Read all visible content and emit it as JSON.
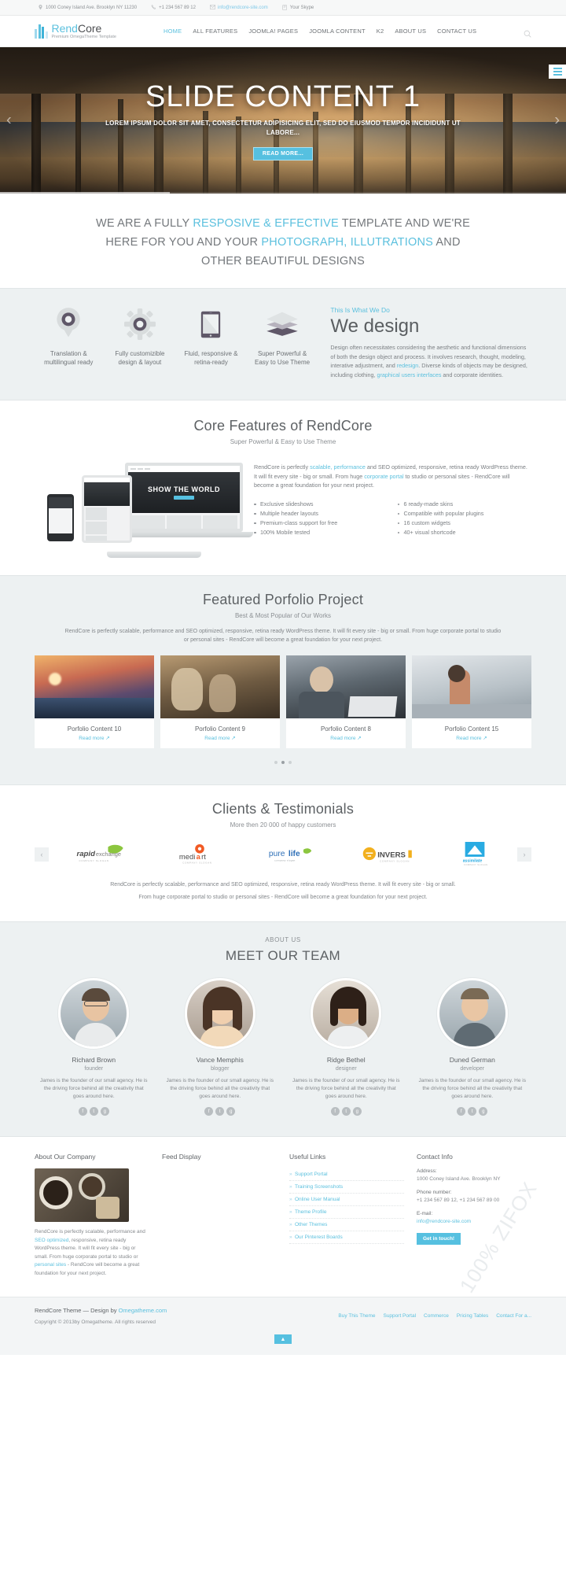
{
  "topbar": {
    "address": "1000 Coney Island Ave. Brooklyn NY 11230",
    "phone": "+1 234 567 89 12",
    "email": "info@rendcore-site.com",
    "skype": "Your Skype",
    "icons": {
      "location": "location-pin-icon",
      "phone": "phone-icon",
      "mail": "envelope-icon",
      "skype": "skype-icon"
    }
  },
  "header": {
    "brand_light": "Rend",
    "brand_bold": "Core",
    "tagline": "Premium OmegaTheme Template",
    "nav": [
      {
        "label": "HOME",
        "active": true
      },
      {
        "label": "ALL FEATURES",
        "active": false
      },
      {
        "label": "JOOMLA! PAGES",
        "active": false
      },
      {
        "label": "JOOMLA CONTENT",
        "active": false
      },
      {
        "label": "K2",
        "active": false
      },
      {
        "label": "ABOUT US",
        "active": false
      },
      {
        "label": "CONTACT US",
        "active": false
      }
    ],
    "search_icon": "search-icon"
  },
  "slider": {
    "title": "SLIDE CONTENT 1",
    "subtitle": "LOREM IPSUM DOLOR SIT AMET, CONSECTETUR ADIPISICING ELIT, SED DO EIUSMOD TEMPOR INCIDIDUNT UT LABORE...",
    "button": "READ MORE...",
    "prev": "‹",
    "next": "›"
  },
  "intro": {
    "line1_a": "WE ARE A FULLY ",
    "line1_hl": "RESPOSIVE & EFFECTIVE",
    "line1_b": " TEMPLATE AND WE'RE",
    "line2_a": "HERE FOR YOU AND YOUR ",
    "line2_hl": "PHOTOGRAPH, ILLUTRATIONS",
    "line2_b": " AND",
    "line3": "OTHER BEAUTIFUL DESIGNS"
  },
  "features": [
    {
      "icon": "location-pin-icon",
      "caption": "Translation &\nmultilingual ready"
    },
    {
      "icon": "gear-icon",
      "caption": "Fully customizible\ndesign & layout"
    },
    {
      "icon": "tablet-icon",
      "caption": "Fluid, responsive &\nretina-ready"
    },
    {
      "icon": "layers-icon",
      "caption": "Super Powerful &\nEasy to Use Theme"
    }
  ],
  "wedesign": {
    "kicker": "This Is What We Do",
    "title": "We design",
    "body_1": "Design often necessitates considering the aesthetic and functional dimensions of both the design object and process. It involves research, thought, modeling, interative adjustment, and ",
    "link_1": "redesign",
    "body_2": ". Diverse kinds of objects may be designed, including clothing, ",
    "link_2": "graphical users interfaces",
    "body_3": " and corporate identities."
  },
  "core": {
    "title": "Core Features of RendCore",
    "subtitle": "Super Powerful & Easy to Use Theme",
    "para_1": "RendCore is perfectly ",
    "link_a": "scalable, performance",
    "para_2": " and SEO optimized, responsive, retina ready WordPress theme. It will fit every site - big or small. From huge ",
    "link_b": "corporate portal",
    "para_3": " to studio or personal sites - RendCore will become a great foundation for your next project.",
    "list_left": [
      "Exclusive slideshows",
      "Multiple header layouts",
      "Premium-class support for free",
      "100% Mobile tested"
    ],
    "list_right": [
      "6 ready-made skins",
      "Compatible with popular plugins",
      "16 custom widgets",
      "40+ visual shortcode"
    ],
    "mock_title": "SHOW THE WORLD"
  },
  "portfolio": {
    "title": "Featured Porfolio Project",
    "subtitle": "Best & Most Popular of Our Works",
    "description": "RendCore is perfectly scalable, performance and SEO optimized, responsive, retina ready WordPress theme. It will fit every site - big or small. From huge corporate portal to studio or personal sites - RendCore will become a great foundation for your next project.",
    "items": [
      {
        "name": "Porfolio Content 10",
        "more": "Read more ↗"
      },
      {
        "name": "Porfolio Content 9",
        "more": "Read more ↗"
      },
      {
        "name": "Porfolio Content 8",
        "more": "Read more ↗"
      },
      {
        "name": "Porfolio Content 15",
        "more": "Read more ↗"
      }
    ],
    "dots": 3,
    "active_dot": 1
  },
  "clients": {
    "title": "Clients & Testimonials",
    "subtitle": "More then 20 000 of happy customers",
    "prev": "‹",
    "next": "›",
    "logos": [
      {
        "name": "rapidexchange",
        "main": "rapid",
        "accent": "exchange",
        "sub": "company slogan"
      },
      {
        "name": "mediart",
        "main": "medi",
        "accent": "art",
        "sub": "company slogan"
      },
      {
        "name": "purelife",
        "main": "pure",
        "accent": "life",
        "sub": "company slogan"
      },
      {
        "name": "invers",
        "main": "INVERS",
        "accent": "",
        "sub": "company slogan"
      },
      {
        "name": "assimilate",
        "main": "assimilate",
        "accent": "",
        "sub": "company slogan"
      }
    ],
    "footer_line1": "RendCore is perfectly scalable, performance and SEO optimized, responsive, retina ready WordPress theme. It will fit every site - big or small.",
    "footer_line2": "From huge corporate portal to studio or personal sites - RendCore will become a great foundation for your next project."
  },
  "team": {
    "kicker": "ABOUT US",
    "title": "MEET OUR TEAM",
    "bio": "James is the founder of our small agency. He is the driving force behind all the creativity that goes around here.",
    "members": [
      {
        "name": "Richard Brown",
        "role": "founder"
      },
      {
        "name": "Vance Memphis",
        "role": "blogger"
      },
      {
        "name": "Ridge Bethel",
        "role": "designer"
      },
      {
        "name": "Duned German",
        "role": "developer"
      }
    ],
    "social": [
      "f",
      "t",
      "g"
    ]
  },
  "footer": {
    "about": {
      "heading": "About Our Company",
      "text_1": "RendCore is perfectly scalable, performance and ",
      "link_1": "SEO optimized",
      "text_2": ", responsive, retina ready WordPress theme. It will fit every site - big or small. From huge corporate portal to studio or ",
      "link_2": "personal sites",
      "text_3": " - RendCore will become a great foundation for your next project."
    },
    "feed": {
      "heading": "Feed Display"
    },
    "links": {
      "heading": "Useful Links",
      "items": [
        "Support Portal",
        "Training Screenshots",
        "Online User Manual",
        "Theme Profile",
        "Other Themes",
        "Our Pinterest Boards"
      ]
    },
    "contact": {
      "heading": "Contact Info",
      "address_label": "Address:",
      "address_value": "1000 Coney Island Ave. Brooklyn NY",
      "phone_label": "Phone number:",
      "phone_value": "+1 234 567 89 12, +1 234 567 89 00",
      "email_label": "E-mail:",
      "email_value": "info@rendcore-site.com",
      "button": "Get in touch!"
    }
  },
  "footer_bottom": {
    "theme_text": "RendCore Theme — Design by ",
    "theme_link": "Omegatheme.com",
    "copyright": "Copyright © 2013by Omegatheme. All rights reserved",
    "links": [
      "Buy This Theme",
      "Support Portal",
      "Commerce",
      "Pricing Tables",
      "Contact For a..."
    ],
    "to_top": "▲",
    "watermark": "100% ZIFOX"
  },
  "colors": {
    "accent": "#5bc0de",
    "accent_dark": "#3fb3d8",
    "text": "#6b6f73",
    "heading": "#5d6164",
    "grey_bg": "#edf1f2"
  }
}
